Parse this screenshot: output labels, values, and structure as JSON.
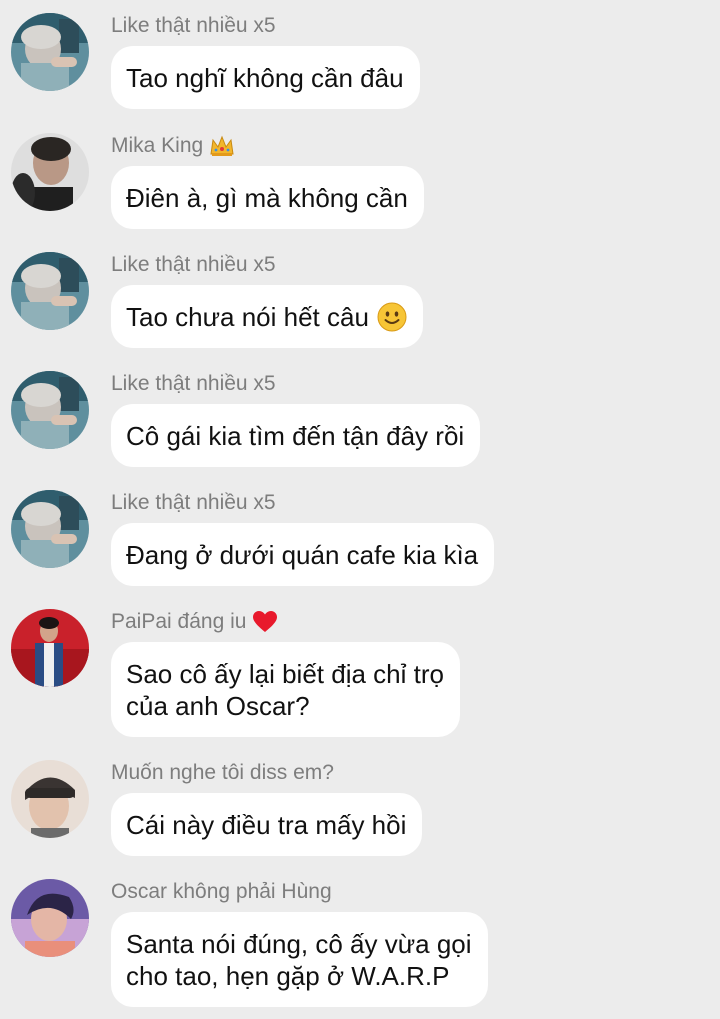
{
  "messages": [
    {
      "sender": "Like thật nhiều x5",
      "lines": [
        "Tao nghĩ không cần đâu"
      ],
      "avatar": "avatar-like",
      "badge": null,
      "emoji": null
    },
    {
      "sender": "Mika King",
      "lines": [
        "Điên à, gì mà không cần"
      ],
      "avatar": "avatar-mika",
      "badge": "crown-icon",
      "emoji": null
    },
    {
      "sender": "Like thật nhiều x5",
      "lines": [
        "Tao chưa nói hết câu"
      ],
      "avatar": "avatar-like",
      "badge": null,
      "emoji": "smile-emoji-icon"
    },
    {
      "sender": "Like thật nhiều x5",
      "lines": [
        "Cô gái kia tìm đến tận đây rồi"
      ],
      "avatar": "avatar-like",
      "badge": null,
      "emoji": null
    },
    {
      "sender": "Like thật nhiều x5",
      "lines": [
        "Đang ở dưới quán cafe kia kìa"
      ],
      "avatar": "avatar-like",
      "badge": null,
      "emoji": null
    },
    {
      "sender": "PaiPai đáng iu",
      "lines": [
        "Sao cô ấy lại biết địa chỉ trọ",
        "của anh Oscar?"
      ],
      "avatar": "avatar-paipai",
      "badge": "heart-icon",
      "emoji": null
    },
    {
      "sender": "Muốn nghe tôi diss em?",
      "lines": [
        "Cái này điều tra mấy hồi"
      ],
      "avatar": "avatar-muon",
      "badge": null,
      "emoji": null
    },
    {
      "sender": "Oscar không phải Hùng",
      "lines": [
        "Santa nói đúng, cô ấy vừa gọi",
        "cho tao, hẹn gặp ở W.A.R.P"
      ],
      "avatar": "avatar-oscar",
      "badge": null,
      "emoji": null
    }
  ],
  "colors": {
    "background": "#ececec",
    "bubble": "#ffffff",
    "sender_text": "#7d7d7d",
    "message_text": "#111111",
    "heart": "#e8192c",
    "crown": "#f2b62c"
  }
}
